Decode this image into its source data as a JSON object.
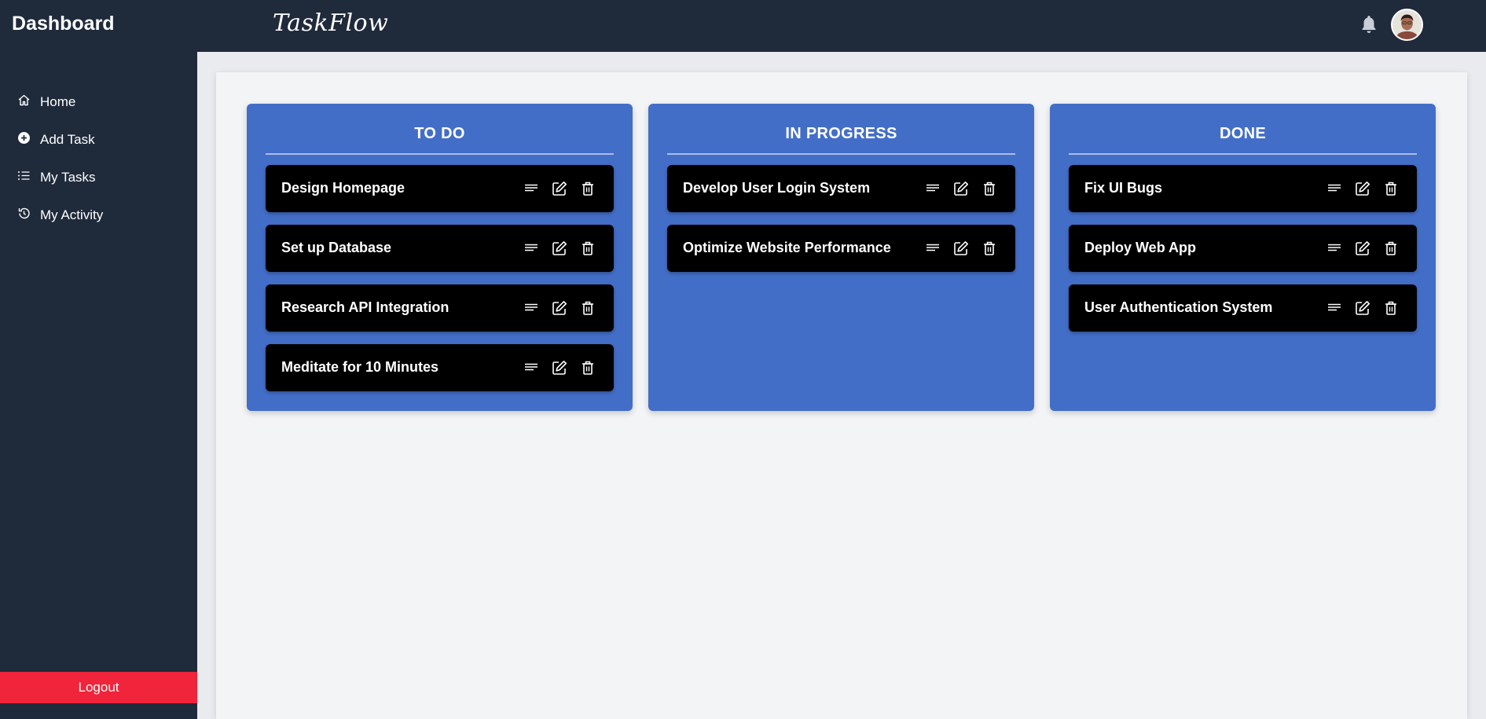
{
  "header": {
    "dashboard_title": "Dashboard",
    "brand": "TaskFlow",
    "bell_icon": "bell-icon",
    "avatar": "user-avatar"
  },
  "sidebar": {
    "items": [
      {
        "label": "Home",
        "icon": "home-icon"
      },
      {
        "label": "Add Task",
        "icon": "plus-circle-icon"
      },
      {
        "label": "My Tasks",
        "icon": "list-icon"
      },
      {
        "label": "My Activity",
        "icon": "history-icon"
      }
    ],
    "logout_label": "Logout"
  },
  "board": {
    "columns": [
      {
        "title": "TO DO",
        "tasks": [
          "Design Homepage",
          "Set up Database",
          "Research API Integration",
          "Meditate for 10 Minutes"
        ]
      },
      {
        "title": "IN PROGRESS",
        "tasks": [
          "Develop User Login System",
          "Optimize Website Performance"
        ]
      },
      {
        "title": "DONE",
        "tasks": [
          "Fix UI Bugs",
          "Deploy Web App",
          "User Authentication System"
        ]
      }
    ],
    "card_icons": [
      "details-icon",
      "edit-icon",
      "delete-icon"
    ]
  },
  "colors": {
    "topbar": "#1f2a3b",
    "sidebar": "#1f2a3b",
    "column": "#436ec8",
    "card": "#000000",
    "logout": "#f0243a"
  }
}
